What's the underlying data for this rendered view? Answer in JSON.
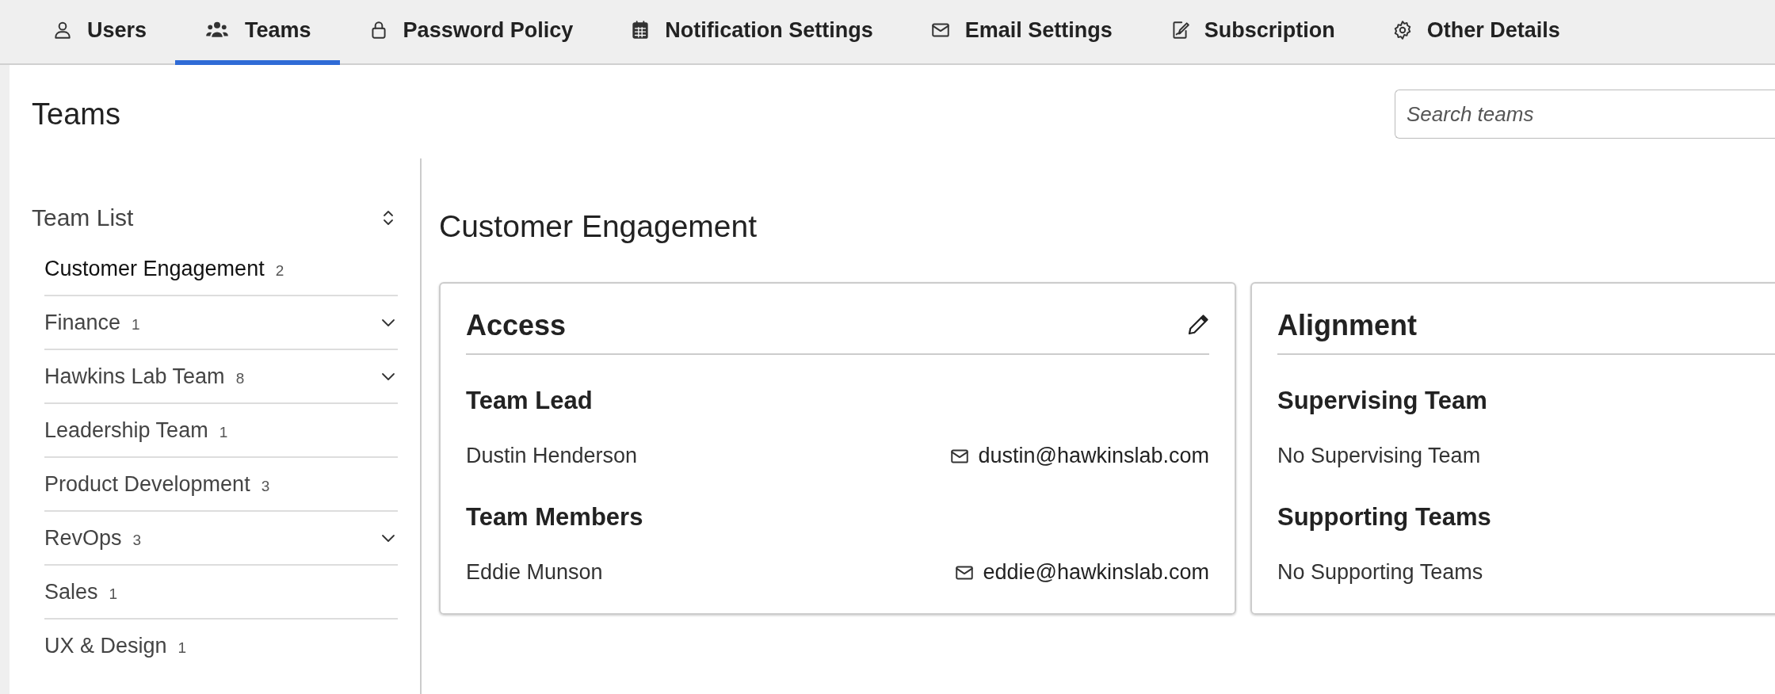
{
  "tabs": [
    {
      "label": "Users",
      "selected": false
    },
    {
      "label": "Teams",
      "selected": true
    },
    {
      "label": "Password Policy",
      "selected": false
    },
    {
      "label": "Notification Settings",
      "selected": false
    },
    {
      "label": "Email Settings",
      "selected": false
    },
    {
      "label": "Subscription",
      "selected": false
    },
    {
      "label": "Other Details",
      "selected": false
    }
  ],
  "page_title": "Teams",
  "search": {
    "placeholder": "Search teams"
  },
  "team_list": {
    "title": "Team List",
    "items": [
      {
        "name": "Customer Engagement",
        "count": "2",
        "expandable": false,
        "selected": true
      },
      {
        "name": "Finance",
        "count": "1",
        "expandable": true,
        "selected": false
      },
      {
        "name": "Hawkins Lab Team",
        "count": "8",
        "expandable": true,
        "selected": false
      },
      {
        "name": "Leadership Team",
        "count": "1",
        "expandable": false,
        "selected": false
      },
      {
        "name": "Product Development",
        "count": "3",
        "expandable": false,
        "selected": false
      },
      {
        "name": "RevOps",
        "count": "3",
        "expandable": true,
        "selected": false
      },
      {
        "name": "Sales",
        "count": "1",
        "expandable": false,
        "selected": false
      },
      {
        "name": "UX & Design",
        "count": "1",
        "expandable": false,
        "selected": false
      }
    ]
  },
  "detail": {
    "title": "Customer Engagement",
    "cards": [
      {
        "title": "Access",
        "editable": true,
        "sections": [
          {
            "heading": "Team Lead",
            "entries": [
              {
                "name": "Dustin Henderson",
                "email": "dustin@hawkinslab.com"
              }
            ]
          },
          {
            "heading": "Team Members",
            "entries": [
              {
                "name": "Eddie Munson",
                "email": "eddie@hawkinslab.com"
              }
            ]
          }
        ]
      },
      {
        "title": "Alignment",
        "sections": [
          {
            "heading": "Supervising Team",
            "entries": [
              {
                "name": "No Supervising Team"
              }
            ]
          },
          {
            "heading": "Supporting Teams",
            "entries": [
              {
                "name": "No Supporting Teams"
              }
            ]
          }
        ]
      }
    ]
  }
}
